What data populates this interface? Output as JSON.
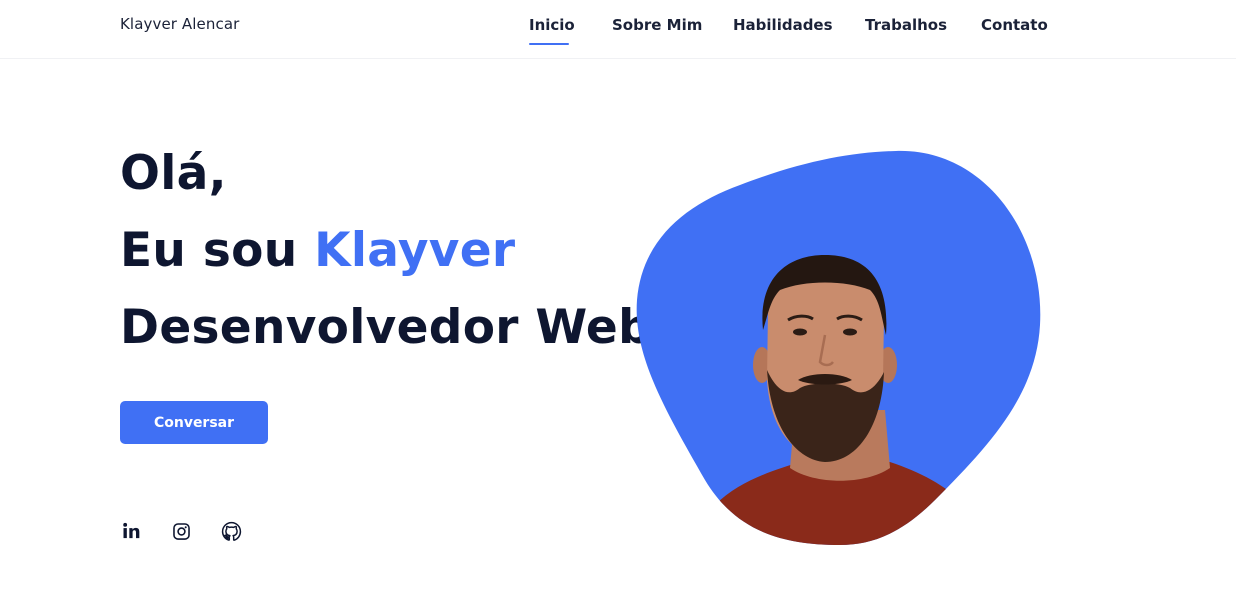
{
  "header": {
    "logo": "Klayver Alencar",
    "nav": [
      {
        "label": "Inicio",
        "active": true
      },
      {
        "label": "Sobre Mim",
        "active": false
      },
      {
        "label": "Habilidades",
        "active": false
      },
      {
        "label": "Trabalhos",
        "active": false
      },
      {
        "label": "Contato",
        "active": false
      }
    ]
  },
  "hero": {
    "greeting": "Olá,",
    "intro_prefix": "Eu sou ",
    "name": "Klayver",
    "role": "Desenvolvedor Web",
    "cta_label": "Conversar"
  },
  "social": [
    {
      "icon": "linkedin-icon"
    },
    {
      "icon": "instagram-icon"
    },
    {
      "icon": "github-icon"
    }
  ],
  "colors": {
    "accent": "#4070f4",
    "text": "#0e1630",
    "shirt": "#8a2a1a"
  }
}
